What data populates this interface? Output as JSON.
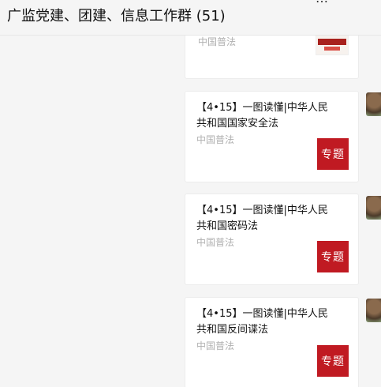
{
  "header": {
    "title": "广监党建、团建、信息工作群 (51)",
    "more_glyph": "…"
  },
  "messages": [
    {
      "text": "",
      "source": "中国普法",
      "thumb_type": "poster",
      "thumb_text": ""
    },
    {
      "text": "【4•15】一图读懂|中华人民共和国国家安全法",
      "source": "中国普法",
      "thumb_type": "tag",
      "thumb_text": "专题"
    },
    {
      "text": "【4•15】一图读懂|中华人民共和国密码法",
      "source": "中国普法",
      "thumb_type": "tag",
      "thumb_text": "专题"
    },
    {
      "text": "【4•15】一图读懂|中华人民共和国反间谍法",
      "source": "中国普法",
      "thumb_type": "tag",
      "thumb_text": "专题"
    }
  ],
  "colors": {
    "thumb_red": "#c01a22",
    "source_gray": "#b0b0b0",
    "background": "#f5f5f5"
  }
}
